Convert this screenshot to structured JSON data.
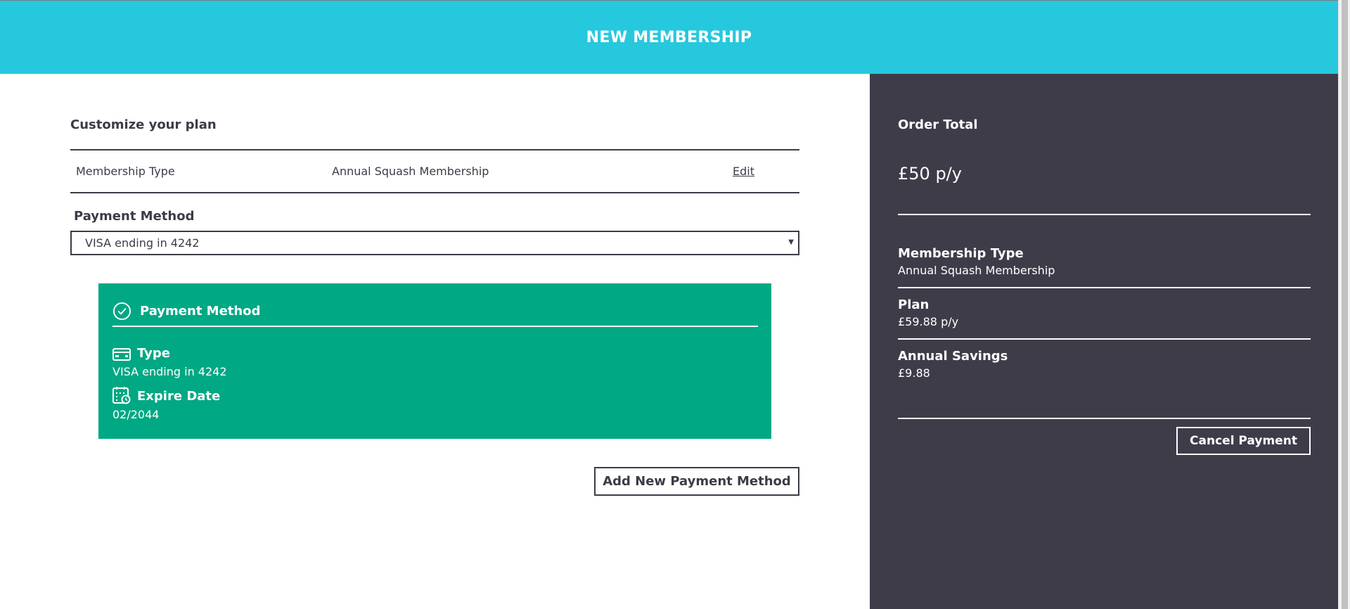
{
  "header": {
    "title": "NEW MEMBERSHIP"
  },
  "plan": {
    "heading": "Customize your plan",
    "row_label": "Membership Type",
    "row_value": "Annual Squash Membership",
    "edit_label": "Edit"
  },
  "payment": {
    "label": "Payment Method",
    "selected": "VISA ending in 4242",
    "card": {
      "title": "Payment Method",
      "type_label": "Type",
      "type_value": "VISA ending in 4242",
      "expire_label": "Expire Date",
      "expire_value": "02/2044"
    },
    "add_button": "Add New Payment Method"
  },
  "order": {
    "title": "Order Total",
    "price": "£50 p/y",
    "membership_label": "Membership Type",
    "membership_value": "Annual Squash Membership",
    "plan_label": "Plan",
    "plan_value": "£59.88 p/y",
    "savings_label": "Annual Savings",
    "savings_value": "£9.88",
    "cancel_button": "Cancel Payment"
  },
  "colors": {
    "header": "#26c8de",
    "card": "#00a884",
    "sidebar": "#3f3c4a",
    "text": "#3d3b47"
  }
}
